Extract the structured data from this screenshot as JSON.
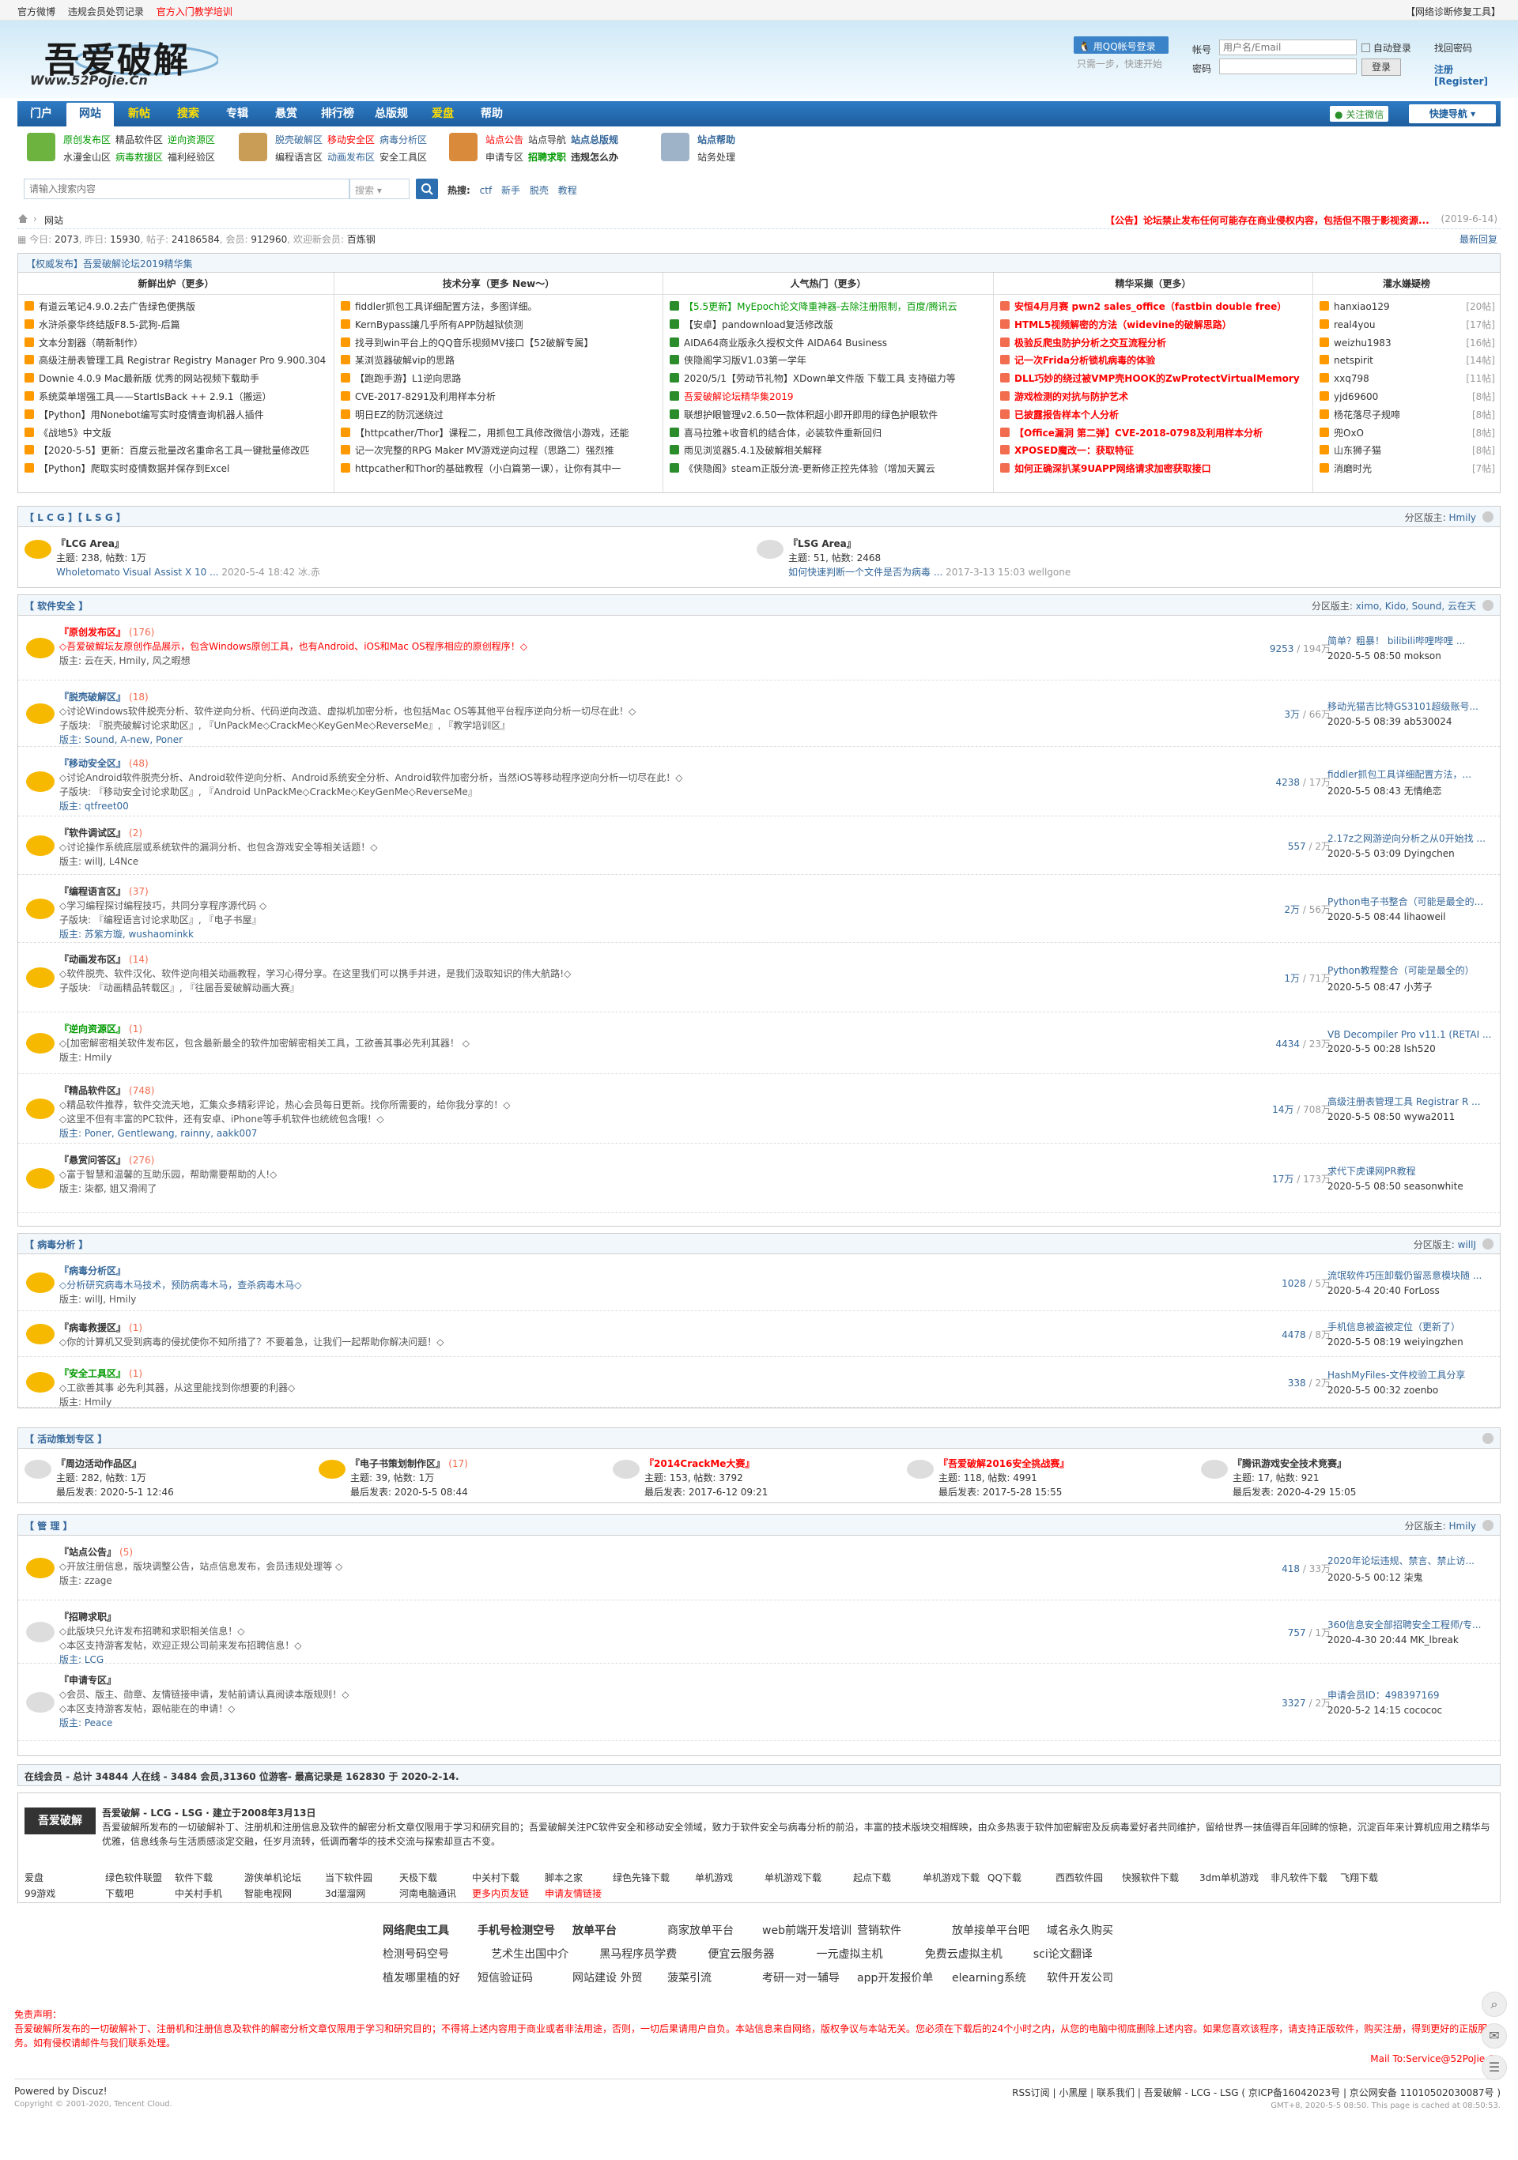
{
  "topbar": {
    "links": [
      "官方微博",
      "违规会员处罚记录",
      "官方入门教学培训"
    ],
    "right": "【网络诊断修复工具】"
  },
  "logo": {
    "big": "吾爱破解",
    "small": "Www.52PoJie.Cn"
  },
  "login": {
    "qq": "用QQ帐号登录",
    "qqsub": "只需一步，快速开始",
    "account_label": "帐号",
    "account_placeholder": "用户名/Email",
    "auto": "自动登录",
    "findpw": "找回密码",
    "password_label": "密码",
    "login_btn": "登录",
    "register": "注册[Register]"
  },
  "nav": {
    "items": [
      "门户",
      "网站",
      "新帖",
      "搜索",
      "专辑",
      "悬赏",
      "排行榜",
      "总版规",
      "爱盘",
      "帮助"
    ],
    "follow": "关注微信",
    "quick": "快捷导航"
  },
  "quick": [
    {
      "r1": [
        "原创发布区",
        "精品软件区",
        "逆向资源区"
      ],
      "r2": [
        "水漫金山区",
        "病毒救援区",
        "福利经验区"
      ]
    },
    {
      "r1": [
        "脱壳破解区",
        "移动安全区",
        "病毒分析区"
      ],
      "r2": [
        "编程语言区",
        "动画发布区",
        "安全工具区"
      ]
    },
    {
      "r1": [
        "站点公告",
        "站点导航",
        "站点总版规"
      ],
      "r2": [
        "申请专区",
        "招聘求职",
        "违规怎么办"
      ]
    },
    {
      "r1": [
        "站点帮助"
      ],
      "r2": [
        "站务处理"
      ]
    }
  ],
  "search": {
    "placeholder": "请输入搜索内容",
    "select": "搜索",
    "hot_label": "热搜:",
    "hot": [
      "ctf",
      "新手",
      "脱壳",
      "教程"
    ]
  },
  "crumb": {
    "text": "网站",
    "ann": "【公告】论坛禁止发布任何可能存在商业侵权内容，包括但不限于影视资源...",
    "date": "(2019-6-14)"
  },
  "stats": {
    "today_l": "今日:",
    "today": "2073",
    "yest_l": "昨日:",
    "yest": "15930",
    "posts_l": "帖子:",
    "posts": "24186584",
    "members_l": "会员:",
    "members": "912960",
    "welcome": "欢迎新会员:",
    "newm": "百炼钢",
    "latest": "最新回复"
  },
  "hot": {
    "head": "【权威发布】吾爱破解论坛2019精华集",
    "titles": [
      "新鲜出炉（更多）",
      "技术分享（更多 New～）",
      "人气热门（更多）",
      "精华采撷（更多）",
      "灌水嫌疑榜"
    ],
    "c1": [
      "有道云笔记4.9.0.2去广告绿色便携版",
      "水浒杀豪华终结版F8.5-武狗-后篇",
      "文本分割器（萌新制作）",
      "高级注册表管理工具 Registrar Registry Manager Pro 9.900.304",
      "Downie 4.0.9 Mac最新版 优秀的网站视频下载助手",
      "系统菜单增强工具——StartIsBack ++ 2.9.1（搬运）",
      "【Python】用Nonebot编写实时疫情查询机器人插件",
      "《战地5》中文版",
      "【2020-5-5】更新：百度云批量改名重命名工具一键批量修改匹",
      "【Python】爬取实时疫情数据并保存到Excel"
    ],
    "c2": [
      "fiddler抓包工具详细配置方法，多图详细。",
      "KernBypass讓几乎所有APP防越狱侦测",
      "找寻到win平台上的QQ音乐视频MV接口【52破解专属】",
      "某浏览器破解vip的思路",
      "【跑跑手游】L1逆向思路",
      "CVE-2017-8291及利用样本分析",
      "明日EZ的防沉迷绕过",
      "【httpcather/Thor】课程二，用抓包工具修改微信小游戏，还能",
      "记一次完整的RPG Maker MV游戏逆向过程（思路二）强烈推",
      "httpcather和Thor的基础教程（小白篇第一课），让你有其中一"
    ],
    "c3": [
      "【5.5更新】MyEpoch论文降重神器-去除注册限制，百度/腾讯云",
      "【安卓】pandownload复活修改版",
      "AIDA64商业版永久授权文件 AIDA64 Business",
      "侠隐阁学习版V1.03第一学年",
      "2020/5/1【劳动节礼物】XDown单文件版 下载工具 支持磁力等",
      "吾爱破解论坛精华集2019",
      "联想护眼管理v2.6.50一款体积超小即开即用的绿色护眼软件",
      "喜马拉雅+收音机的结合体，必装软件重新回归",
      "雨见浏览器5.4.1及破解相关解释",
      "《侠隐阁》steam正版分流-更新修正控先体验（增加天翼云"
    ],
    "c4": [
      "安恒4月月赛 pwn2 sales_office（fastbin double free）",
      "HTML5视频解密的方法（widevine的破解思路）",
      "极验反爬虫防护分析之交互流程分析",
      "记一次Frida分析锁机病毒的体验",
      "DLL巧妙的绕过被VMP壳HOOK的ZwProtectVirtualMemory",
      "游戏检测的对抗与防护艺术",
      "已披露报告样本个人分析",
      "【Office漏洞 第二弹】CVE-2018-0798及利用样本分析",
      "XPOSED魔改一：获取特征",
      "如何正确深扒某9UAPP网络请求加密获取接口"
    ],
    "c5": [
      [
        "hanxiao129",
        "[20帖]"
      ],
      [
        "real4you",
        "[17帖]"
      ],
      [
        "weizhu1983",
        "[16帖]"
      ],
      [
        "netspirit",
        "[14帖]"
      ],
      [
        "xxq798",
        "[11帖]"
      ],
      [
        "yjd69600",
        "[8帖]"
      ],
      [
        "杨花落尽子规啼",
        "[8帖]"
      ],
      [
        "兜OxO",
        "[8帖]"
      ],
      [
        "山东狮子猫",
        "[8帖]"
      ],
      [
        "消磨时光",
        "[7帖]"
      ]
    ]
  },
  "lcg": {
    "title": "【 L C G 】【 L S G 】",
    "mod_label": "分区版主:",
    "mod": "Hmily",
    "a": {
      "t": "『LCG Area』",
      "s": "主题: 238, 帖数: 1万",
      "l": "Wholetomato Visual Assist X 10 ...",
      "lt": "2020-5-4 18:42 冰.赤"
    },
    "b": {
      "t": "『LSG Area』",
      "s": "主题: 51, 帖数: 2468",
      "l": "如何快速判断一个文件是否为病毒 ...",
      "lt": "2017-3-13 15:03 wellgone"
    }
  },
  "soft": {
    "title": "【 软件安全 】",
    "mod_label": "分区版主:",
    "mod": "ximo, Kido, Sound, 云在天",
    "rows": [
      {
        "n": "『原创发布区』",
        "c": "(176)",
        "d": "◇吾爱破解坛友原创作品展示，包含Windows原创工具，也有Android、iOS和Mac OS程序相应的原创程序！◇",
        "m": "版主: 云在天, Hmily, 风之暇想",
        "m2": "",
        "s": "9253",
        "s2": " / 194万",
        "lt": "简单？粗暴！ bilibili哔哩哔哩 ...",
        "lb": "2020-5-5 08:50 mokson"
      },
      {
        "n": "『脱壳破解区』",
        "c": "(18)",
        "d": "◇讨论Windows软件脱壳分析、软件逆向分析、代码逆向改造、虚拟机加密分析，也包括Mac OS等其他平台程序逆向分析一切尽在此！◇",
        "m": "子版块: 『脱壳破解讨论求助区』, 『UnPackMe◇CrackMe◇KeyGenMe◇ReverseMe』, 『教学培训区』",
        "m2": "版主: Sound, A-new, Poner",
        "s": "3万",
        "s2": " / 66万",
        "lt": "移动光猫吉比特GS3101超级账号...",
        "lb": "2020-5-5 08:39 ab530024"
      },
      {
        "n": "『移动安全区』",
        "c": "(48)",
        "d": "◇讨论Android软件脱壳分析、Android软件逆向分析、Android系统安全分析、Android软件加密分析，当然iOS等移动程序逆向分析一切尽在此！◇",
        "m": "子版块: 『移动安全讨论求助区』, 『Android UnPackMe◇CrackMe◇KeyGenMe◇ReverseMe』",
        "m2": "版主: qtfreet00",
        "s": "4238",
        "s2": " / 17万",
        "lt": "fiddler抓包工具详细配置方法，...",
        "lb": "2020-5-5 08:43 无情绝恋"
      },
      {
        "n": "『软件调试区』",
        "c": "(2)",
        "d": "◇讨论操作系统底层或系统软件的漏洞分析、也包含游戏安全等相关话题！◇",
        "m": "版主: willJ, L4Nce",
        "m2": "",
        "s": "557",
        "s2": " / 2万",
        "lt": "2.17z之网游逆向分析之从0开始找 ...",
        "lb": "2020-5-5 03:09 Dyingchen"
      },
      {
        "n": "『编程语言区』",
        "c": "(37)",
        "d": "◇学习编程探讨编程技巧，共同分享程序源代码 ◇",
        "m": "子版块: 『编程语言讨论求助区』, 『电子书屋』",
        "m2": "版主: 苏紫方璇, wushaominkk",
        "s": "2万",
        "s2": " / 56万",
        "lt": "Python电子书整合（可能是最全的...",
        "lb": "2020-5-5 08:44 lihaoweil"
      },
      {
        "n": "『动画发布区』",
        "c": "(14)",
        "d": "◇软件脱壳、软件汉化、软件逆向相关动画教程，学习心得分享。在这里我们可以携手并进，是我们汲取知识的伟大航路!◇",
        "m": "子版块: 『动画精品转载区』, 『往届吾爱破解动画大赛』",
        "m2": "",
        "s": "1万",
        "s2": " / 71万",
        "lt": "Python教程整合（可能是最全的）",
        "lb": "2020-5-5 08:47 小芳子"
      },
      {
        "n": "『逆向资源区』",
        "c": "(1)",
        "d": "◇[加密解密相关软件发布区，包含最新最全的软件加密解密相关工具，工欲善其事必先利其器！ ◇",
        "m": "版主: Hmily",
        "m2": "",
        "s": "4434",
        "s2": " / 23万",
        "lt": "VB Decompiler Pro v11.1 (RETAI ...",
        "lb": "2020-5-5 00:28 lsh520"
      },
      {
        "n": "『精品软件区』",
        "c": "(748)",
        "d": "◇精品软件推荐，软件交流天地，汇集众多精彩评论，热心会员每日更新。找你所需要的，给你我分享的！◇",
        "m": "◇这里不但有丰富的PC软件，还有安卓、iPhone等手机软件也统统包含哦！◇",
        "m2": "版主: Poner, Gentlewang, rainny, aakk007",
        "s": "14万",
        "s2": " / 708万",
        "lt": "高级注册表管理工具 Registrar R ...",
        "lb": "2020-5-5 08:50 wywa2011"
      },
      {
        "n": "『悬赏问答区』",
        "c": "(276)",
        "d": "◇富于智慧和温馨的互助乐园，帮助需要帮助的人!◇",
        "m": "版主: 柒都, 姐又滑闹了",
        "m2": "",
        "s": "17万",
        "s2": " / 173万",
        "lt": "求代下虎课网PR教程",
        "lb": "2020-5-5 08:50 seasonwhite"
      }
    ]
  },
  "virus": {
    "title": "【 病毒分析 】",
    "mod_label": "分区版主:",
    "mod": "willJ",
    "rows": [
      {
        "n": "『病毒分析区』",
        "c": "",
        "d": "◇分析研究病毒木马技术，预防病毒木马，查杀病毒木马◇",
        "m": "版主: willJ, Hmily",
        "s": "1028",
        "s2": " / 5万",
        "lt": "流氓软件巧压卸载仍留恶意模块随 ...",
        "lb": "2020-5-4 20:40 ForLoss"
      },
      {
        "n": "『病毒救援区』",
        "c": "(1)",
        "d": "◇你的计算机又受到病毒的侵扰使你不知所措了？不要着急，让我们一起帮助你解决问题！◇",
        "m": "",
        "s": "4478",
        "s2": " / 8万",
        "lt": "手机信息被盗被定位（更新了）",
        "lb": "2020-5-5 08:19 weiyingzhen"
      },
      {
        "n": "『安全工具区』",
        "c": "(1)",
        "d": "◇工欲善其事 必先利其器，从这里能找到你想要的利器◇",
        "m": "版主: Hmily",
        "s": "338",
        "s2": " / 2万",
        "lt": "HashMyFiles-文件校验工具分享",
        "lb": "2020-5-5 00:32 zoenbo"
      }
    ]
  },
  "activity": {
    "title": "【 活动策划专区 】",
    "cells": [
      {
        "t": "『周边活动作品区』",
        "s": "主题: 282, 帖数: 1万",
        "l": "最后发表: 2020-5-1 12:46"
      },
      {
        "t": "『电子书策划制作区』",
        "c": "(17)",
        "s": "主题: 39, 帖数: 1万",
        "l": "最后发表: 2020-5-5 08:44"
      },
      {
        "t": "『2014CrackMe大赛』",
        "s": "主题: 153, 帖数: 3792",
        "l": "最后发表: 2017-6-12 09:21"
      },
      {
        "t": "『吾爱破解2016安全挑战赛』",
        "s": "主题: 118, 帖数: 4991",
        "l": "最后发表: 2017-5-28 15:55"
      },
      {
        "t": "『腾讯游戏安全技术竞赛』",
        "s": "主题: 17, 帖数: 921",
        "l": "最后发表: 2020-4-29 15:05"
      }
    ]
  },
  "admin": {
    "title": "【 管 理 】",
    "mod_label": "分区版主:",
    "mod": "Hmily",
    "rows": [
      {
        "n": "『站点公告』",
        "c": "(5)",
        "d": "◇开放注册信息，版块调整公告，站点信息发布，会员违规处理等 ◇",
        "m": "版主: zzage",
        "m2": "",
        "s": "418",
        "s2": " / 33万",
        "lt": "2020年论坛违规、禁言、禁止访...",
        "lb": "2020-5-5 00:12 柒鬼"
      },
      {
        "n": "『招聘求职』",
        "c": "",
        "d": "◇此版块只允许发布招聘和求职相关信息！◇",
        "m": "◇本区支持游客发帖，欢迎正规公司前来发布招聘信息！◇",
        "m2": "版主: LCG",
        "s": "757",
        "s2": " / 1万",
        "lt": "360信息安全部招聘安全工程师/专...",
        "lb": "2020-4-30 20:44 MK_lbreak"
      },
      {
        "n": "『申请专区』",
        "c": "",
        "d": "◇会员、版主、勋章、友情链接申请，发帖前请认真阅读本版规则！◇",
        "m": "◇本区支持游客发帖，跟帖能在的申请！◇",
        "m2": "版主: Peace",
        "s": "3327",
        "s2": " / 2万",
        "lt": "申请会员ID：498397169",
        "lb": "2020-5-2 14:15 cocococ"
      }
    ]
  },
  "online": "在线会员 - 总计 34844 人在线 - 3484 会员,31360 位游客- 最高记录是 162830 于 2020-2-14.",
  "about": {
    "logo": "吾爱破解",
    "title": "吾爱破解 - LCG - LSG · 建立于2008年3月13日",
    "desc": "吾爱破解所发布的一切破解补丁、注册机和注册信息及软件的解密分析文章仅限用于学习和研究目的；吾爱破解关注PC软件安全和移动安全领域，致力于软件安全与病毒分析的前沿，丰富的技术版块交相辉映，由众多热衷于软件加密解密及反病毒爱好者共同维护，留给世界一抹值得百年回眸的惊艳，沉淀百年来计算机应用之精华与优雅，信息线条与生活质感淡定交融，任岁月流转，低调而奢华的技术交流与探索却亘古不变。",
    "links_r1": [
      "爱盘",
      "绿色软件联盟",
      "软件下载",
      "游侠单机论坛",
      "当下软件园",
      "天极下载",
      "中关村下载",
      "脚本之家",
      "绿色先锋下载",
      "单机游戏",
      "单机游戏下载",
      "起点下载",
      "单机游戏下载",
      "QQ下载",
      "西西软件园",
      "快猴软件下载",
      "3dm单机游戏",
      "非凡软件下载",
      "飞翔下载"
    ],
    "links_r2": [
      "99游戏",
      "下载吧",
      "中关村手机",
      "智能电视网",
      "3d溜溜网",
      "河南电脑通讯",
      "更多内页友链",
      "申请友情链接"
    ]
  },
  "ads": {
    "r1": [
      "网络爬虫工具",
      "手机号检测空号",
      "放单平台",
      "商家放单平台",
      "web前端开发培训",
      "营销软件",
      "放单接单平台吧",
      "域名永久购买"
    ],
    "r2": [
      "检测号码空号",
      "艺术生出国中介",
      "黑马程序员学费",
      "便宜云服务器",
      "一元虚拟主机",
      "免费云虚拟主机",
      "sci论文翻译"
    ],
    "r3": [
      "植发哪里植的好",
      "短信验证码",
      "网站建设 外贸",
      "菠菜引流",
      "考研一对一辅导",
      "app开发报价单",
      "elearning系统",
      "软件开发公司"
    ]
  },
  "disc": {
    "title": "免责声明：",
    "body": "吾爱破解所发布的一切破解补丁、注册机和注册信息及软件的解密分析文章仅限用于学习和研究目的；不得将上述内容用于商业或者非法用途，否则，一切后果请用户自负。本站信息来自网络，版权争议与本站无关。您必须在下载后的24个小时之内，从您的电脑中彻底删除上述内容。如果您喜欢该程序，请支持正版软件，购买注册，得到更好的正版服务。如有侵权请邮件与我们联系处理。",
    "mail": "Mail To:Service@52PoJie.Cn"
  },
  "footer": {
    "pb": "Powered by Discuz!",
    "cp": "Copyright © 2001-2020, Tencent Cloud.",
    "links": "RSS订阅 | 小黑屋 | 联系我们 | 吾爱破解 - LCG - LSG ( 京ICP备16042023号 | 京公网安备 11010502030087号 )",
    "gmt": "GMT+8, 2020-5-5 08:50. This page is cached at 08:50:53."
  }
}
